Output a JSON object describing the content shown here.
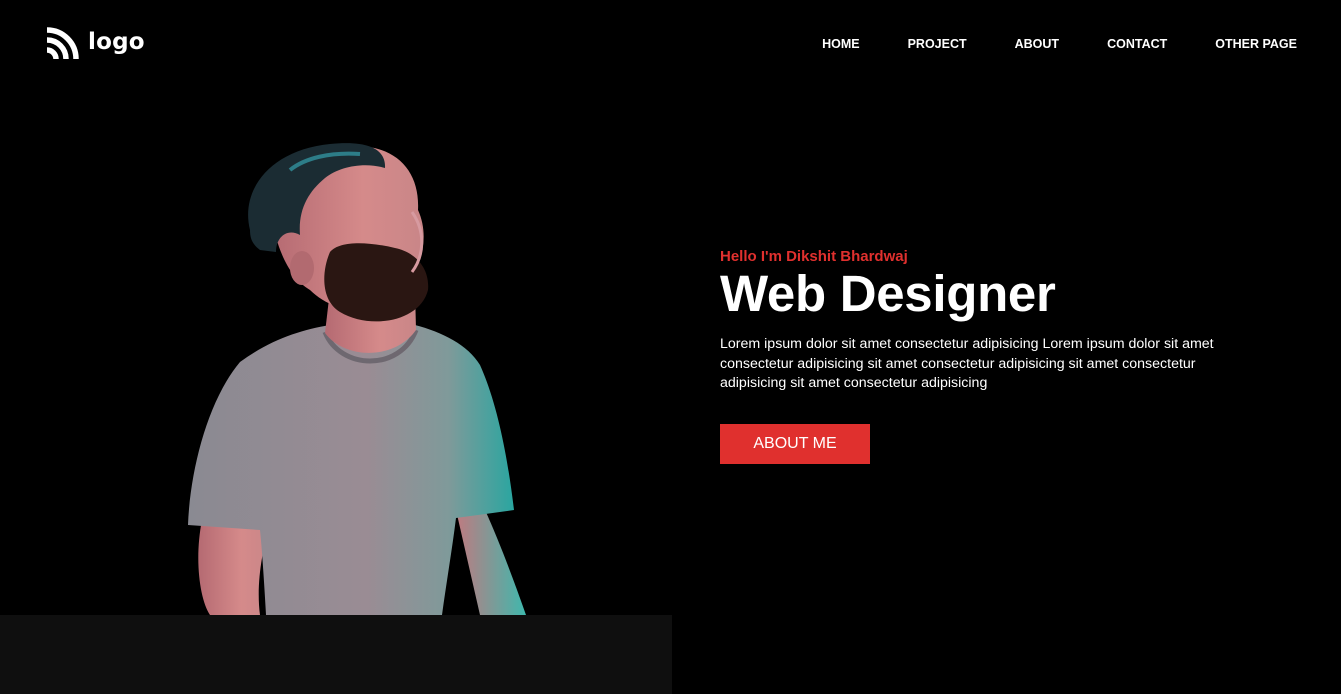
{
  "header": {
    "logo_text": "logo",
    "logo_icon": "wifi-arcs-icon",
    "nav": [
      "HOME",
      "PROJECT",
      "ABOUT",
      "CONTACT",
      "OTHER PAGE"
    ]
  },
  "hero": {
    "greeting": "Hello I'm Dikshit Bhardwaj",
    "title": "Web Designer",
    "description": "Lorem ipsum dolor sit amet consectetur adipisicing Lorem ipsum dolor sit amet consectetur adipisicing sit amet consectetur adipisicing sit amet consectetur adipisicing sit amet consectetur adipisicing",
    "button_label": "ABOUT ME"
  },
  "colors": {
    "background": "#000000",
    "accent": "#e0302e",
    "text": "#ffffff",
    "panel": "#0f0f0f",
    "rim_light": "#16c8b8"
  }
}
